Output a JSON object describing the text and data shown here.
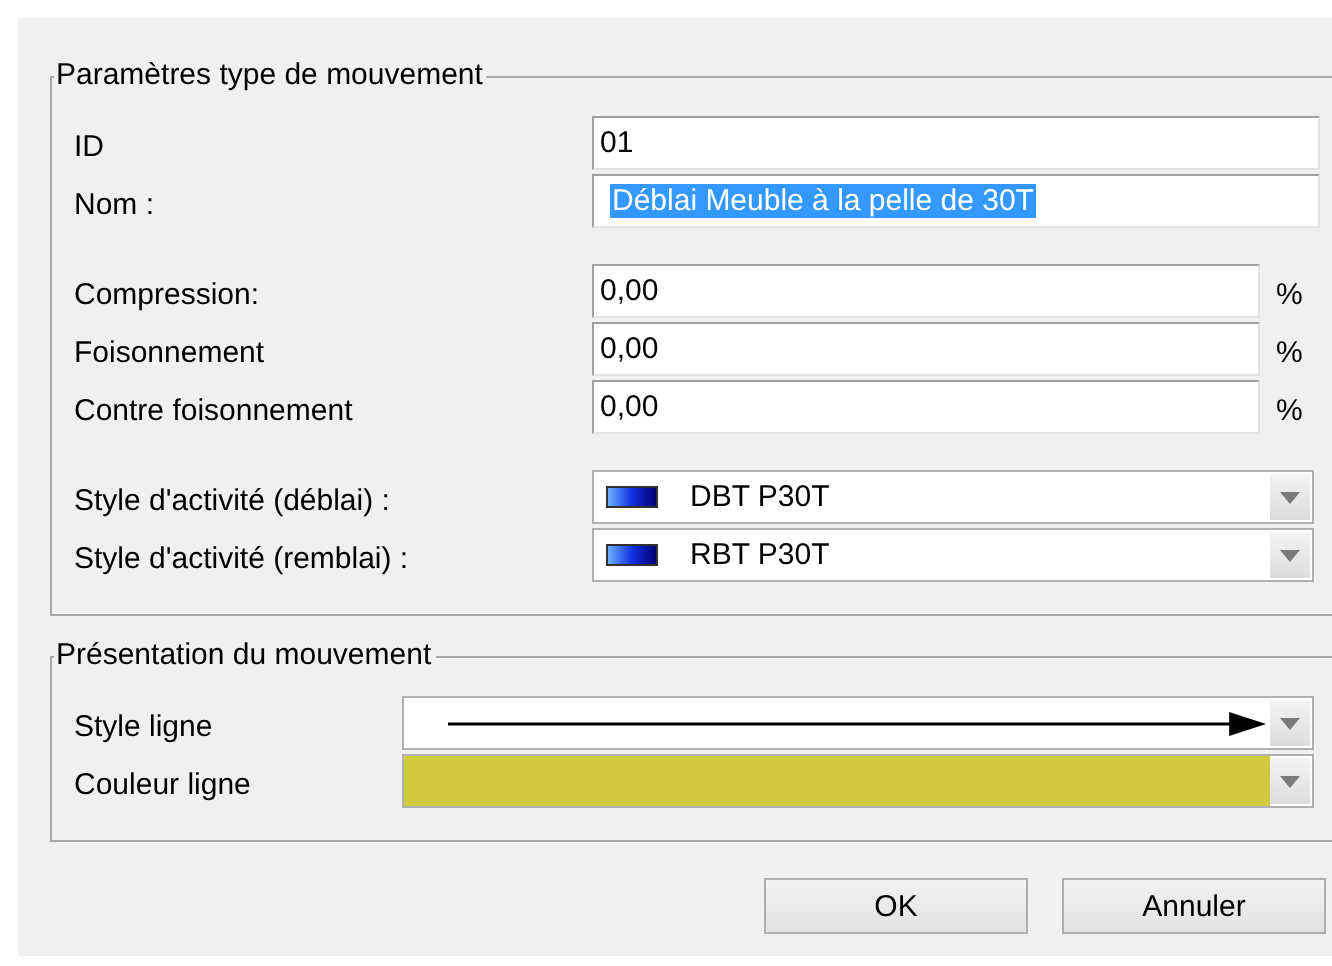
{
  "group1": {
    "title": "Paramètres type de mouvement",
    "sections": [
      [
        {
          "kind": "text",
          "label": "ID",
          "value": "01",
          "selected": false
        },
        {
          "kind": "text",
          "label": "Nom :",
          "value": "Déblai Meuble à la pelle de 30T",
          "selected": true
        }
      ],
      [
        {
          "kind": "percent",
          "label": "Compression:",
          "value": "0,00",
          "unit": "%"
        },
        {
          "kind": "percent",
          "label": "Foisonnement",
          "value": "0,00",
          "unit": "%"
        },
        {
          "kind": "percent",
          "label": "Contre foisonnement",
          "value": "0,00",
          "unit": "%"
        }
      ],
      [
        {
          "kind": "style",
          "label": "Style d'activité (déblai) :",
          "value": "DBT P30T"
        },
        {
          "kind": "style",
          "label": "Style d'activité (remblai) :",
          "value": "RBT P30T"
        }
      ]
    ]
  },
  "group2": {
    "title": "Présentation du mouvement",
    "rows": [
      {
        "kind": "line",
        "label": "Style ligne"
      },
      {
        "kind": "color",
        "label": "Couleur ligne",
        "color": "#cfcb3c"
      }
    ]
  },
  "buttons": [
    "OK",
    "Annuler"
  ]
}
